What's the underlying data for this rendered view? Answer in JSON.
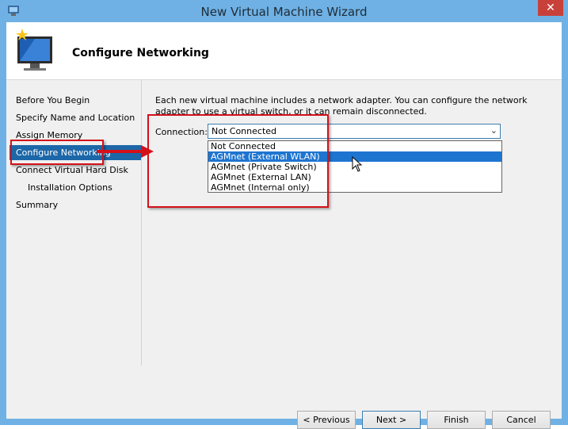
{
  "window": {
    "title": "New Virtual Machine Wizard",
    "close_glyph": "✕"
  },
  "header": {
    "page_title": "Configure Networking"
  },
  "steps": [
    {
      "label": "Before You Begin",
      "active": false,
      "sub": false
    },
    {
      "label": "Specify Name and Location",
      "active": false,
      "sub": false
    },
    {
      "label": "Assign Memory",
      "active": false,
      "sub": false
    },
    {
      "label": "Configure Networking",
      "active": true,
      "sub": false
    },
    {
      "label": "Connect Virtual Hard Disk",
      "active": false,
      "sub": false
    },
    {
      "label": "Installation Options",
      "active": false,
      "sub": true
    },
    {
      "label": "Summary",
      "active": false,
      "sub": false
    }
  ],
  "content": {
    "description": "Each new virtual machine includes a network adapter. You can configure the network adapter to use a virtual switch, or it can remain disconnected.",
    "connection_label": "Connection:",
    "connection_value": "Not Connected",
    "options": [
      "Not Connected",
      "AGMnet (External WLAN)",
      "AGMnet (Private Switch)",
      "AGMnet (External LAN)",
      "AGMnet (Internal only)"
    ],
    "highlighted_option": "AGMnet (External WLAN)"
  },
  "buttons": {
    "previous": "< Previous",
    "next": "Next >",
    "finish": "Finish",
    "cancel": "Cancel"
  },
  "colors": {
    "titlebar": "#6fb1e4",
    "active_step": "#1c67a8",
    "selection": "#1e75d0",
    "callout": "#d4111a",
    "close": "#c7413a"
  }
}
